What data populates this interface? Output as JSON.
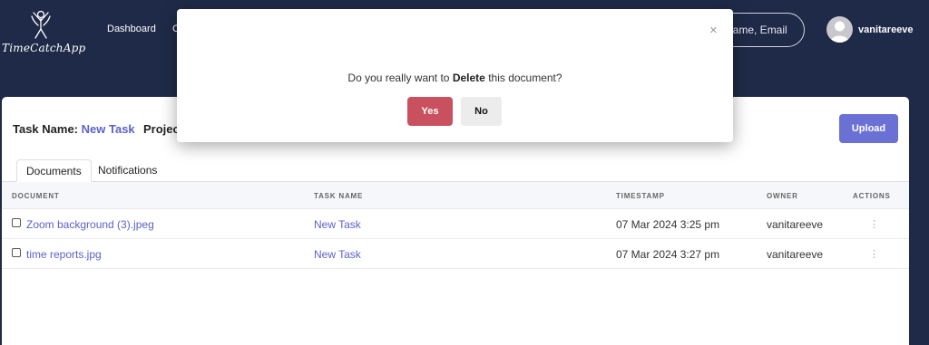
{
  "app": {
    "logo_text": "TimeCatchApp"
  },
  "nav": {
    "dashboard": "Dashboard",
    "partial_item": "C"
  },
  "search": {
    "visible_text": "name, Email"
  },
  "user": {
    "name": "vanitareeve"
  },
  "task": {
    "label": "Task Name:",
    "name": "New Task",
    "project_label": "Projec"
  },
  "upload_label": "Upload",
  "tabs": [
    {
      "label": "Documents",
      "active": true
    },
    {
      "label": "Notifications",
      "active": false
    }
  ],
  "table": {
    "columns": [
      "DOCUMENT",
      "TASK NAME",
      "TIMESTAMP",
      "OWNER",
      "ACTIONS"
    ],
    "rows": [
      {
        "document": "Zoom background (3).jpeg",
        "task_name": "New Task",
        "timestamp": "07 Mar 2024 3:25 pm",
        "owner": "vanitareeve"
      },
      {
        "document": "time reports.jpg",
        "task_name": "New Task",
        "timestamp": "07 Mar 2024 3:27 pm",
        "owner": "vanitareeve"
      }
    ]
  },
  "modal": {
    "close_symbol": "×",
    "question_prefix": "Do you really want to",
    "question_bold": "Delete",
    "question_suffix": "this document?",
    "yes_label": "Yes",
    "no_label": "No"
  },
  "colors": {
    "nav_bg": "#1f2a48",
    "accent": "#5b62c9",
    "upload_btn": "#6b70d5",
    "yes_btn": "#c9515f"
  }
}
